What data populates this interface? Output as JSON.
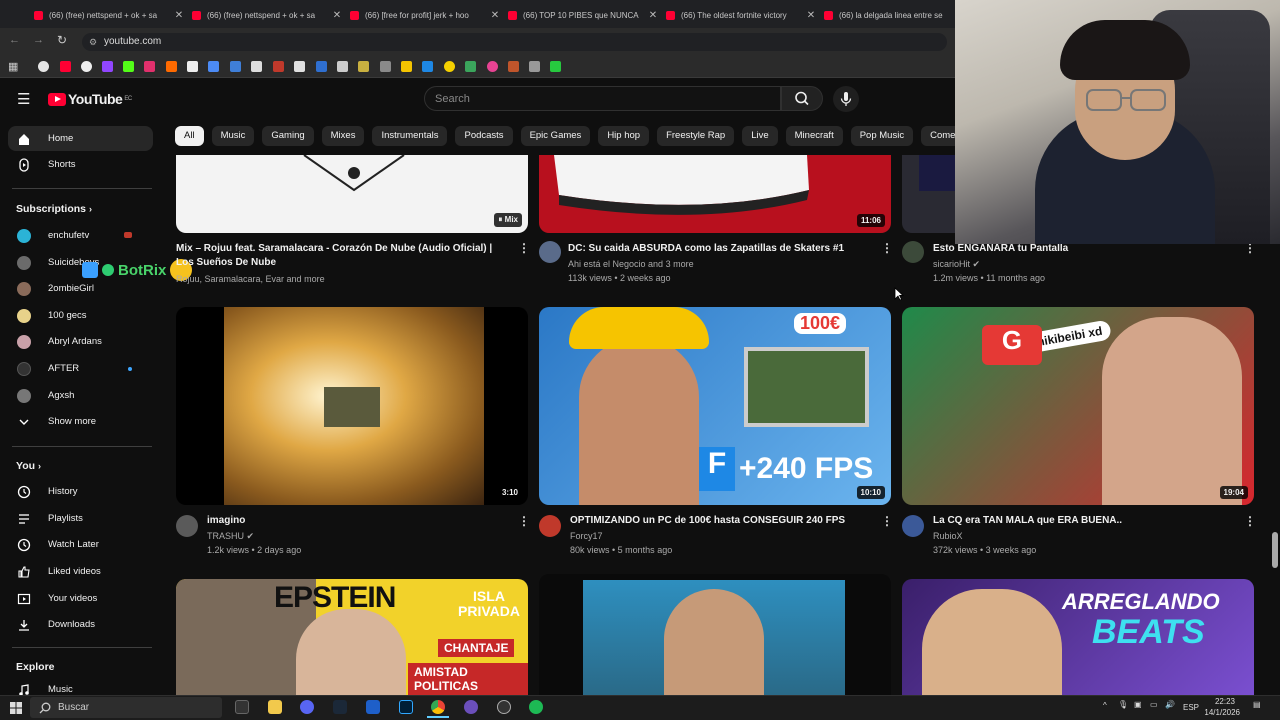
{
  "browser": {
    "tabs": [
      {
        "title": "(66) (free) nettspend + ok + sa"
      },
      {
        "title": "(66) (free) nettspend + ok + sa"
      },
      {
        "title": "(66) [free for profit] jerk + hoo"
      },
      {
        "title": "(66) TOP 10 PIBES que NUNCA"
      },
      {
        "title": "(66) The oldest fortnite victory"
      },
      {
        "title": "(66) la delgada linea entre se"
      }
    ],
    "url": "youtube.com"
  },
  "header": {
    "logo_text": "YouTube",
    "region": "EC",
    "search_placeholder": "Search"
  },
  "chips": [
    "All",
    "Music",
    "Gaming",
    "Mixes",
    "Instrumentals",
    "Podcasts",
    "Epic Games",
    "Hip hop",
    "Freestyle Rap",
    "Live",
    "Minecraft",
    "Pop Music",
    "Comedy"
  ],
  "sidebar": {
    "home": "Home",
    "shorts": "Shorts",
    "subscriptions_title": "Subscriptions",
    "subscriptions": [
      {
        "name": "enchufetv",
        "color": "#2bb3d6"
      },
      {
        "name": "Suicideboys",
        "color": "#6b6b6b"
      },
      {
        "name": "2ombieGirl",
        "color": "#8a6b5a"
      },
      {
        "name": "100 gecs",
        "color": "#e8d28a"
      },
      {
        "name": "Abryl Ardans",
        "color": "#c9a1a9"
      },
      {
        "name": "AFTER",
        "color": "#333333"
      },
      {
        "name": "Agxsh",
        "color": "#777777"
      }
    ],
    "show_more": "Show more",
    "you_title": "You",
    "you_items": [
      "History",
      "Playlists",
      "Watch Later",
      "Liked videos",
      "Your videos",
      "Downloads"
    ],
    "explore_title": "Explore",
    "explore_items": [
      "Music"
    ]
  },
  "overlay": {
    "botrix": "BotRix"
  },
  "videos": [
    {
      "title": "Mix – Rojuu feat. Saramalacara - Corazón De Nube (Audio Oficial) | Los Sueños De Nube",
      "channel": "Rojuu, Saramalacara, Evar and more",
      "meta": "",
      "badge": "Mix",
      "thumb_color": "#f3f3f3"
    },
    {
      "title": "DC: Su caida ABSURDA como las Zapatillas de Skaters #1",
      "channel": "Ahi está el Negocio and 3 more",
      "meta": "113k views • 2 weeks ago",
      "badge": "11:06",
      "thumb_color": "#b8101e"
    },
    {
      "title": "Esto ENGANARA tu Pantalla",
      "channel": "sicarioHit",
      "meta": "1.2m views • 11 months ago",
      "badge": "",
      "thumb_color": "#2a2a33"
    },
    {
      "title": "imagino",
      "channel": "TRASHU",
      "meta": "1.2k views • 2 days ago",
      "badge": "3:10",
      "thumb_color": "#c8922e"
    },
    {
      "title": "OPTIMIZANDO un PC de 100€ hasta CONSEGUIR 240 FPS",
      "channel": "Forcy17",
      "meta": "80k views • 5 months ago",
      "badge": "10:10",
      "thumb_color": "#3d8fd1"
    },
    {
      "title": "La CQ era TAN MALA que ERA BUENA..",
      "channel": "RubioX",
      "meta": "372k views • 3 weeks ago",
      "badge": "19:04",
      "thumb_color": "#d8262e"
    },
    {
      "title": "EPSTEIN ISLA PRIVADA CHANTAJE AMISTAD POLITICAS",
      "channel": "",
      "meta": "",
      "badge": "",
      "thumb_color": "#e8d01a"
    },
    {
      "title": "",
      "channel": "",
      "meta": "",
      "badge": "",
      "thumb_color": "#2e7fa8"
    },
    {
      "title": "ARREGLANDO BEATS",
      "channel": "",
      "meta": "",
      "badge": "",
      "thumb_color": "#6a3fb0"
    }
  ],
  "thumb_text": {
    "v5_price": "100€",
    "v5_fps": "+240 FPS",
    "v6_tag": "chikibeibi xd",
    "v7_a": "EPSTEIN",
    "v7_b": "ISLA PRIVADA",
    "v7_c": "CHANTAJE",
    "v7_d": "AMISTAD POLITICAS",
    "v9_a": "ARREGLANDO",
    "v9_b": "BEATS"
  },
  "taskbar": {
    "search": "Buscar",
    "lang": "ESP",
    "time": "22:23",
    "date": "14/1/2026"
  }
}
